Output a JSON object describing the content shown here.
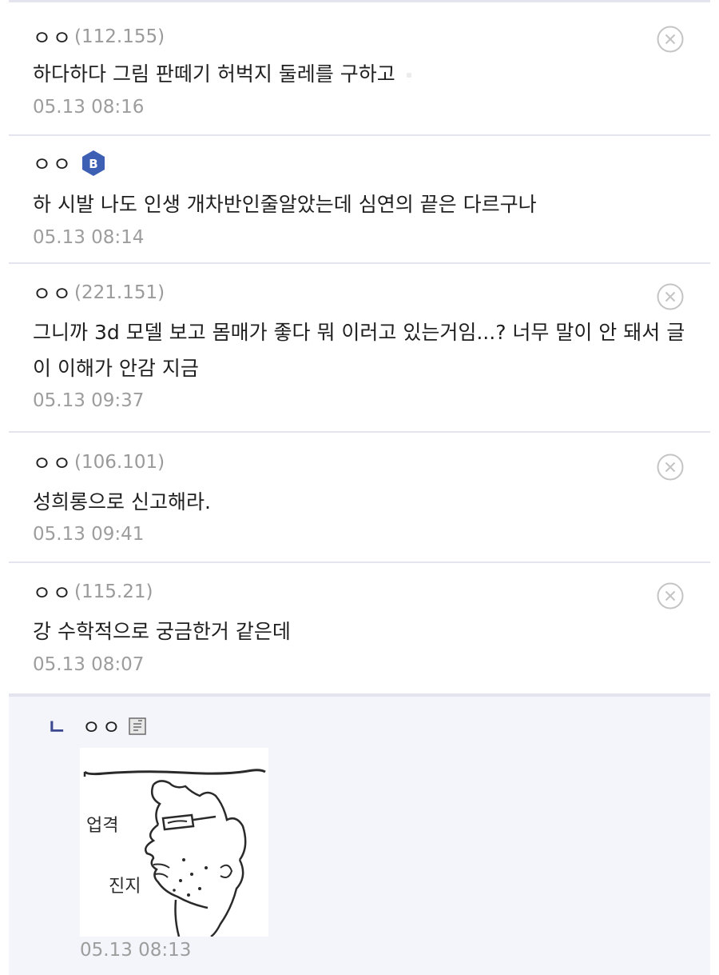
{
  "comments": [
    {
      "nick": "ㅇㅇ",
      "ip": "(112.155)",
      "text": "하다하다 그림 판떼기 허벅지 둘레를 구하고",
      "time": "05.13 08:16",
      "delete_icon": "close-circle-icon"
    },
    {
      "nick": "ㅇㅇ",
      "badge": "B",
      "text": "하 시발 나도 인생 개차반인줄알았는데 심연의 끝은 다르구나",
      "time": "05.13 08:14"
    },
    {
      "nick": "ㅇㅇ",
      "ip": "(221.151)",
      "text": "그니까 3d 모델 보고 몸매가 좋다 뭐 이러고 있는거임...? 너무 말이 안 돼서 글이 이해가 안감 지금",
      "time": "05.13 09:37",
      "delete_icon": "close-circle-icon"
    },
    {
      "nick": "ㅇㅇ",
      "ip": "(106.101)",
      "text": "성희롱으로 신고해라.",
      "time": "05.13 09:41",
      "delete_icon": "close-circle-icon"
    },
    {
      "nick": "ㅇㅇ",
      "ip": "(115.21)",
      "text": "강 수학적으로 궁금한거 같은데",
      "time": "05.13 08:07",
      "delete_icon": "close-circle-icon"
    }
  ],
  "reply": {
    "marker": "ㄴ",
    "nick": "ㅇㅇ",
    "image_text_1": "업격",
    "image_text_2": "진지",
    "time": "05.13 08:13"
  },
  "colors": {
    "badge": "#3d5fb4",
    "reply_bg": "#f4f5fb",
    "divider": "#e3e4ee",
    "reply_marker": "#3b4890"
  }
}
